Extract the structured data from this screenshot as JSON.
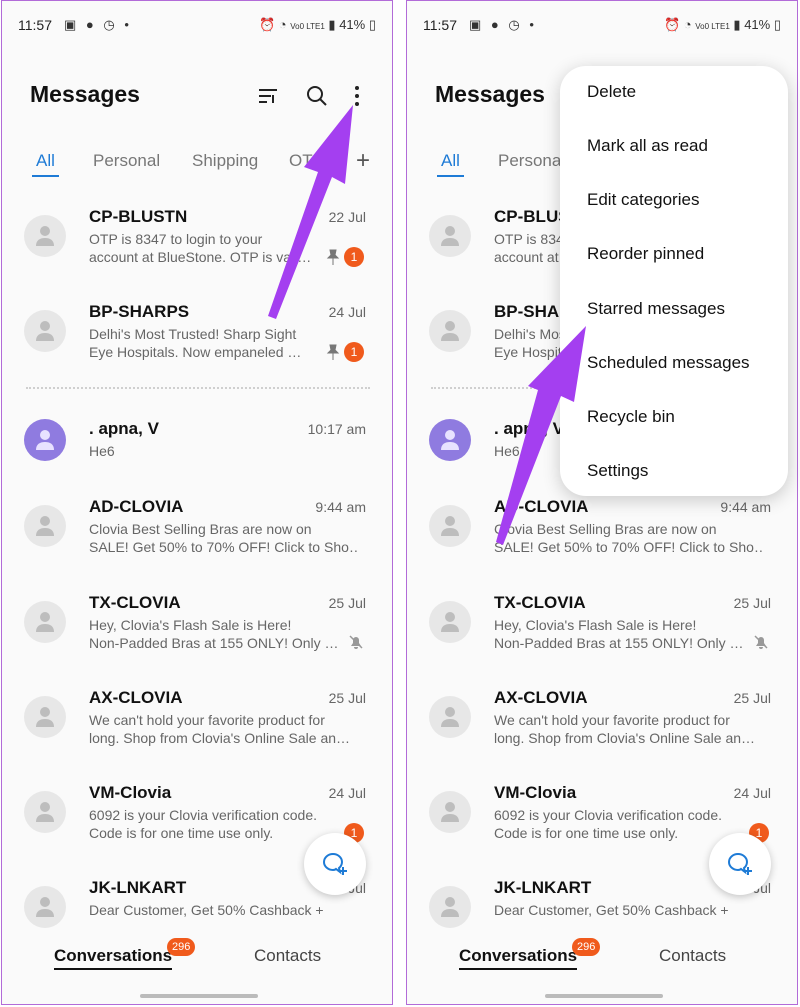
{
  "status": {
    "time": "11:57",
    "battery": "41%",
    "network": "Vo0 LTE1"
  },
  "header": {
    "title": "Messages"
  },
  "tabs": [
    {
      "label": "All",
      "active": true
    },
    {
      "label": "Personal",
      "active": false
    },
    {
      "label": "Shipping",
      "active": false
    },
    {
      "label": "OTP",
      "active": false
    }
  ],
  "conversations": [
    {
      "name": "CP-BLUSTN",
      "date": "22 Jul",
      "line1": "OTP is 8347 to login to your",
      "line2": "account at BlueStone. OTP is vali…",
      "pinned": true,
      "unread": "1"
    },
    {
      "name": "BP-SHARPS",
      "date": "24 Jul",
      "line1": "Delhi's Most Trusted! Sharp Sight",
      "line2": "Eye Hospitals. Now empaneled …",
      "pinned": true,
      "unread": "1"
    },
    {
      "name": ". apna, V",
      "date": "10:17 am",
      "line1": "He6",
      "line2": ""
    },
    {
      "name": "AD-CLOVIA",
      "date": "9:44 am",
      "line1": "Clovia Best Selling Bras are now on",
      "line2": "SALE! Get 50% to 70% OFF! Click to Sho…"
    },
    {
      "name": "TX-CLOVIA",
      "date": "25 Jul",
      "line1": "Hey, Clovia's Flash Sale is Here!",
      "line2": "Non-Padded Bras at 155 ONLY! Only …",
      "muted": true
    },
    {
      "name": "AX-CLOVIA",
      "date": "25 Jul",
      "line1": "We can't hold your favorite product for",
      "line2": "long. Shop from Clovia's Online Sale an…"
    },
    {
      "name": "VM-Clovia",
      "date": "24 Jul",
      "line1": "6092 is your Clovia verification code.",
      "line2": "Code is for one time use only.",
      "unread": "1"
    },
    {
      "name": "JK-LNKART",
      "date": "24 Jul",
      "line1": "Dear Customer, Get 50% Cashback +",
      "line2": ""
    }
  ],
  "bottom_nav": {
    "conversations": "Conversations",
    "badge": "296",
    "contacts": "Contacts"
  },
  "menu": {
    "items": [
      "Delete",
      "Mark all as read",
      "Edit categories",
      "Reorder pinned",
      "Starred messages",
      "Scheduled messages",
      "Recycle bin",
      "Settings"
    ]
  },
  "colors": {
    "accent": "#1e7bd6",
    "badge": "#f05a1c",
    "arrow": "#a43ff0",
    "frame": "#b26bd8"
  },
  "icons": [
    "filter-icon",
    "search-icon",
    "more-vert-icon",
    "plus-icon",
    "contact-avatar-icon",
    "pin-icon",
    "mute-icon",
    "new-chat-icon"
  ]
}
